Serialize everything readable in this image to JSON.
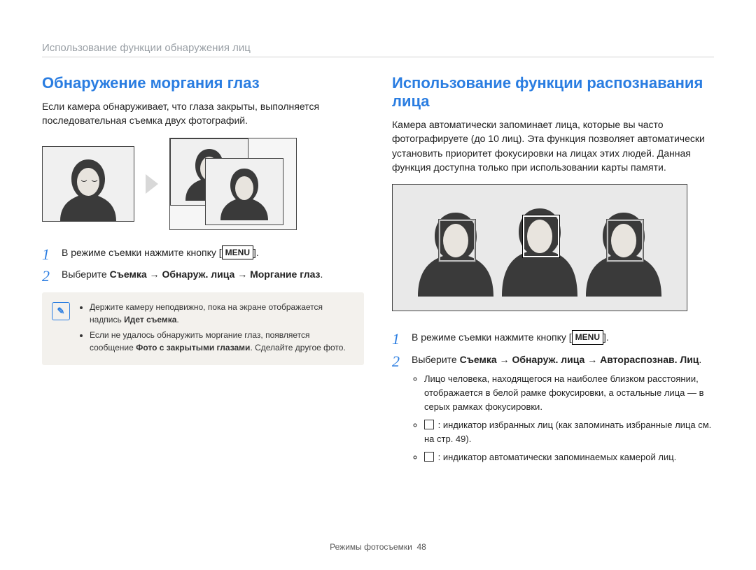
{
  "chapter": "Использование функции обнаружения лиц",
  "left": {
    "heading": "Обнаружение моргания глаз",
    "intro": "Если камера обнаруживает, что глаза закрыты, выполняется последовательная съемка двух фотографий.",
    "step1_pre": "В режиме съемки нажмите кнопку [",
    "step1_btn": "MENU",
    "step1_post": "].",
    "step2_pre": "Выберите ",
    "step2_bold": "Съемка → Обнаруж. лица → Моргание глаз",
    "step2_post": ".",
    "note1_pre": "Держите камеру неподвижно, пока на экране отображается надпись ",
    "note1_bold": "Идет съемка",
    "note1_post": ".",
    "note2_pre": "Если не удалось обнаружить моргание глаз, появляется сообщение ",
    "note2_bold": "Фото с закрытыми глазами",
    "note2_post": ". Сделайте другое фото."
  },
  "right": {
    "heading": "Использование функции распознавания лица",
    "intro": "Камера автоматически запоминает лица, которые вы часто фотографируете (до 10 лиц). Эта функция позволяет автоматически установить приоритет фокусировки на лицах этих людей. Данная функция доступна только при использовании карты памяти.",
    "step1_pre": "В режиме съемки нажмите кнопку [",
    "step1_btn": "MENU",
    "step1_post": "].",
    "step2_pre": "Выберите ",
    "step2_bold": "Съемка → Обнаруж. лица → Автораспознав. Лиц",
    "step2_post": ".",
    "bullet1": "Лицо человека, находящегося на наиболее близком расстоянии, отображается в белой рамке фокусировки, а остальные лица — в серых рамках фокусировки.",
    "bullet2": " : индикатор избранных лиц (как запоминать избранные лица см. на стр. 49).",
    "bullet3": " : индикатор автоматически запоминаемых камерой лиц."
  },
  "footer_label": "Режимы фотосъемки",
  "footer_page": "48"
}
